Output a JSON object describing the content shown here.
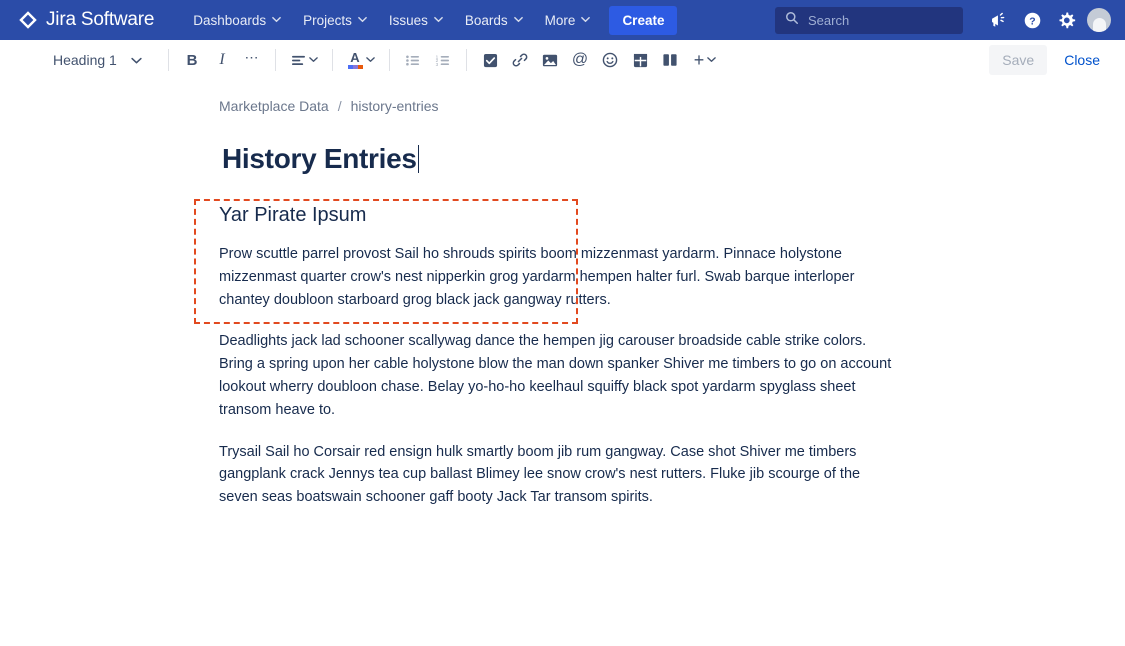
{
  "navbar": {
    "brand": "Jira Software",
    "brand_icon": "jira-diamond-logo",
    "items": [
      {
        "label": "Dashboards",
        "icon": "chevron-down-icon"
      },
      {
        "label": "Projects",
        "icon": "chevron-down-icon"
      },
      {
        "label": "Issues",
        "icon": "chevron-down-icon"
      },
      {
        "label": "Boards",
        "icon": "chevron-down-icon"
      },
      {
        "label": "More",
        "icon": "chevron-down-icon"
      }
    ],
    "create_label": "Create",
    "search": {
      "placeholder": "Search",
      "value": "",
      "icon": "search-icon"
    },
    "right_icons": [
      {
        "name": "announcement-megaphone-icon"
      },
      {
        "name": "help-question-icon"
      },
      {
        "name": "settings-gear-icon"
      },
      {
        "name": "user-avatar"
      }
    ],
    "colors": {
      "background": "#2B4CA8",
      "create_button": "#2D5BE3",
      "search_background": "#22357E"
    }
  },
  "toolbar": {
    "block_type": "Heading 1",
    "block_type_icon": "chevron-down-icon",
    "buttons": [
      {
        "name": "bold-button",
        "label": "B"
      },
      {
        "name": "italic-button",
        "label": "I"
      },
      {
        "name": "more-formatting-button",
        "label": "⋯"
      },
      {
        "name": "text-align-button",
        "label": ""
      },
      {
        "name": "text-color-button",
        "label": "A"
      },
      {
        "name": "bullet-list-button",
        "label": ""
      },
      {
        "name": "numbered-list-button",
        "label": ""
      },
      {
        "name": "task-checkbox-button",
        "label": ""
      },
      {
        "name": "link-button",
        "label": ""
      },
      {
        "name": "image-button",
        "label": ""
      },
      {
        "name": "mention-button",
        "label": "@"
      },
      {
        "name": "emoji-button",
        "label": ""
      },
      {
        "name": "table-button",
        "label": ""
      },
      {
        "name": "layout-columns-button",
        "label": ""
      },
      {
        "name": "insert-more-button",
        "label": "+"
      }
    ],
    "text_color_swatches": [
      "#4C6EF5",
      "#8777D9",
      "#E8590C"
    ],
    "save_label": "Save",
    "save_disabled": true,
    "close_label": "Close"
  },
  "document": {
    "breadcrumb": {
      "parent": "Marketplace Data",
      "separator": "/",
      "current": "history-entries"
    },
    "title": "History Entries",
    "cursor_visible": true,
    "section_heading": "Yar Pirate Ipsum",
    "paragraphs": [
      "Prow scuttle parrel provost Sail ho shrouds spirits boom mizzenmast yardarm. Pinnace holystone mizzenmast quarter crow's nest nipperkin grog yardarm hempen halter furl. Swab barque interloper chantey doubloon starboard grog black jack gangway rutters.",
      "Deadlights jack lad schooner scallywag dance the hempen jig carouser broadside cable strike colors. Bring a spring upon her cable holystone blow the man down spanker Shiver me timbers to go on account lookout wherry doubloon chase. Belay yo-ho-ho keelhaul squiffy black spot yardarm spyglass sheet transom heave to.",
      "Trysail Sail ho Corsair red ensign hulk smartly boom jib rum gangway. Case shot Shiver me timbers gangplank crack Jennys tea cup ballast Blimey lee snow crow's nest rutters. Fluke jib scourge of the seven seas boatswain schooner gaff booty Jack Tar transom spirits."
    ]
  },
  "annotation": {
    "highlight_color": "#E2491F",
    "target": "breadcrumb-and-title-region"
  }
}
